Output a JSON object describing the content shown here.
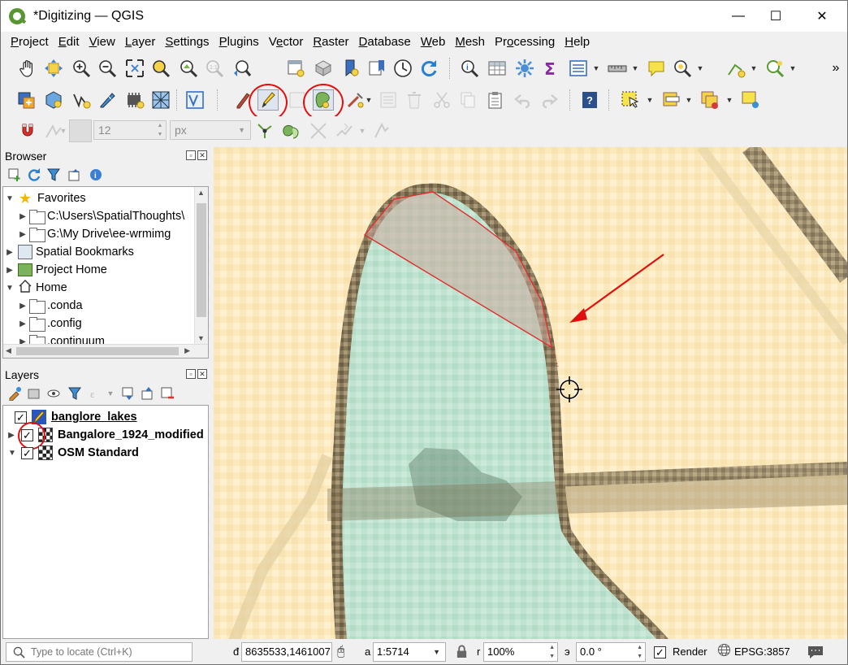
{
  "window": {
    "title": "*Digitizing — QGIS",
    "minimize_glyph": "—",
    "maximize_glyph": "☐",
    "close_glyph": "✕"
  },
  "menu": {
    "items": [
      "Project",
      "Edit",
      "View",
      "Layer",
      "Settings",
      "Plugins",
      "Vector",
      "Raster",
      "Database",
      "Web",
      "Mesh",
      "Processing",
      "Help"
    ],
    "underline_index": [
      0,
      0,
      0,
      0,
      0,
      0,
      1,
      0,
      0,
      0,
      0,
      2,
      0
    ]
  },
  "snapping": {
    "tolerance_value": "12",
    "tolerance_unit": "px"
  },
  "browser_panel": {
    "title": "Browser",
    "items": [
      {
        "label": "Favorites",
        "expanded": true,
        "icon": "star-icon"
      },
      {
        "label": "C:\\Users\\SpatialThoughts\\",
        "icon": "folder-icon"
      },
      {
        "label": "G:\\My Drive\\ee-wrmimg",
        "icon": "folder-icon"
      },
      {
        "label": "Spatial Bookmarks",
        "icon": "bookmark-icon"
      },
      {
        "label": "Project Home",
        "icon": "project-home-icon"
      },
      {
        "label": "Home",
        "expanded": true,
        "icon": "home-icon"
      },
      {
        "label": ".conda",
        "icon": "folder-icon"
      },
      {
        "label": ".config",
        "icon": "folder-icon"
      },
      {
        "label": ".continuum",
        "icon": "folder-icon"
      }
    ]
  },
  "layers_panel": {
    "title": "Layers",
    "layers": [
      {
        "name": "banglore_lakes",
        "checked": true,
        "editing": true
      },
      {
        "name": "Bangalore_1924_modified",
        "checked": true,
        "editing": false
      },
      {
        "name": "OSM Standard",
        "checked": true,
        "editing": false
      }
    ]
  },
  "statusbar": {
    "locate_placeholder": "Type to locate (Ctrl+K)",
    "coordinate_value": "8635533,1461007",
    "scale_value": "1:5714",
    "magnifier_value": "100%",
    "rotation_value": "0.0 °",
    "render_label": "Render",
    "render_checked": true,
    "crs_label": "EPSG:3857"
  },
  "colors": {
    "highlight_red": "#e01010",
    "sketch_red": "#e03030",
    "lake_fill": "#bfe3d0",
    "map_background": "#fbe9c0"
  }
}
